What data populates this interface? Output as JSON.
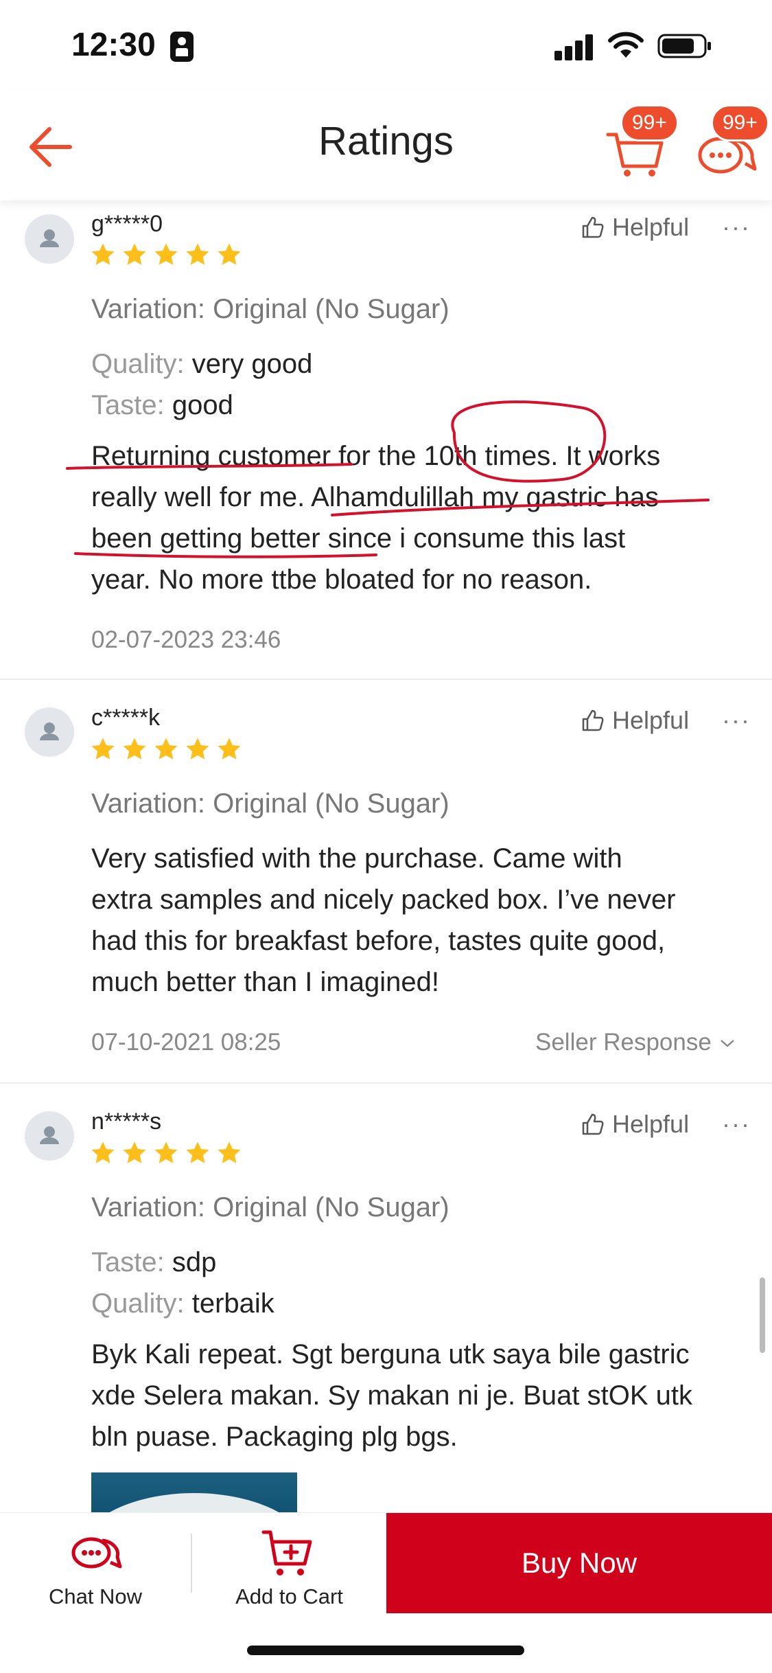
{
  "status_bar": {
    "time": "12:30"
  },
  "header": {
    "title": "Ratings",
    "cart_badge": "99+",
    "chat_badge": "99+"
  },
  "reviews": [
    {
      "username": "g*****0",
      "stars": 5,
      "helpful": "Helpful",
      "more": "···",
      "variation": "Variation: Original (No Sugar)",
      "attributes": [
        {
          "key": "Quality:",
          "value": "very good"
        },
        {
          "key": "Taste:",
          "value": "good"
        }
      ],
      "lines": [
        "Returning customer for the 10th times. It works",
        "really well for me. Alhamdulillah my gastric has",
        "been getting better since i consume this last",
        "year. No more ttbe bloated for no reason."
      ],
      "date": "02-07-2023 23:46"
    },
    {
      "username": "c*****k",
      "stars": 5,
      "helpful": "Helpful",
      "more": "···",
      "variation": "Variation: Original (No Sugar)",
      "lines": [
        "Very satisfied with the purchase.  Came with",
        "extra samples and nicely packed box.  I’ve never",
        "had this for breakfast before, tastes quite good,",
        "much better than I imagined!"
      ],
      "date": "07-10-2021 08:25",
      "seller_response": "Seller Response"
    },
    {
      "username": "n*****s",
      "stars": 5,
      "helpful": "Helpful",
      "more": "···",
      "variation": "Variation: Original (No Sugar)",
      "attributes": [
        {
          "key": "Taste:",
          "value": "sdp"
        },
        {
          "key": "Quality:",
          "value": "terbaik"
        }
      ],
      "lines": [
        "Byk Kali repeat.  Sgt berguna utk saya bile gastric",
        "xde Selera makan.  Sy makan ni je.  Buat stOK utk",
        "bln puase.  Packaging plg bgs."
      ]
    }
  ],
  "bottom_bar": {
    "chat_now": "Chat Now",
    "add_to_cart": "Add to Cart",
    "buy_now": "Buy Now"
  },
  "colors": {
    "accent": "#ee4d2d",
    "buy_now": "#d0011b",
    "star": "#ffbf1a",
    "annotation": "#d4102b"
  }
}
